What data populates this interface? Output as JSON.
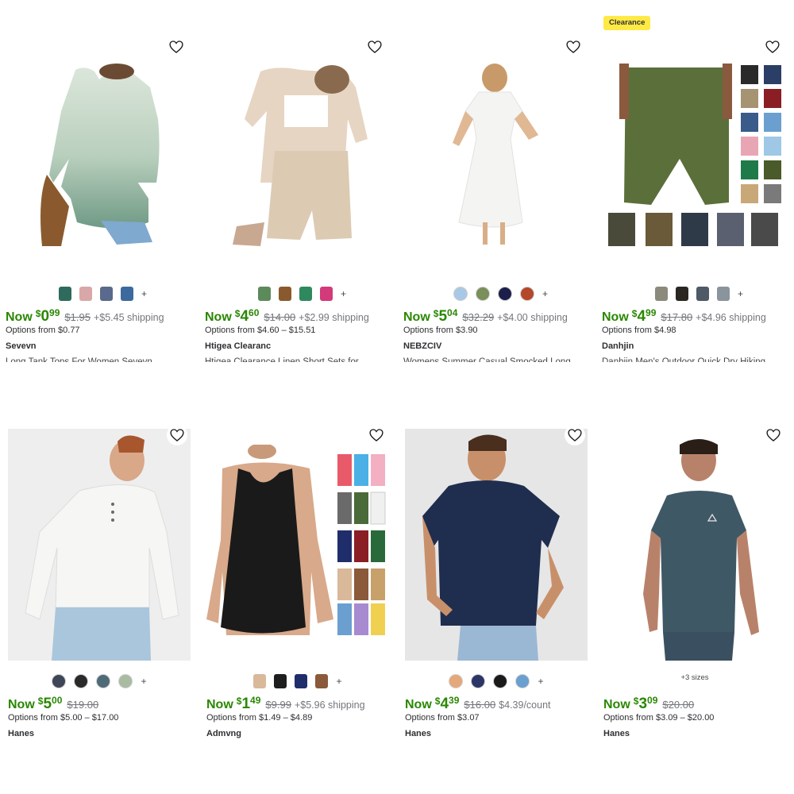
{
  "products": [
    {
      "badge": "",
      "swatch_more": "+",
      "price_prefix": "Now",
      "price_whole": "0",
      "price_cents": "99",
      "was": "$1.95",
      "extra": "+$5.45 shipping",
      "options": "Options from $0.77",
      "brand": "Sevevn",
      "title": "Long Tank Tops For Women Sevevn",
      "swatch_colors": [
        "#2f6b5c",
        "#d9a7a7",
        "#5a6a8c",
        "#3c6a9e"
      ]
    },
    {
      "badge": "",
      "swatch_more": "+",
      "price_prefix": "Now",
      "price_whole": "4",
      "price_cents": "60",
      "was": "$14.00",
      "extra": "+$2.99 shipping",
      "options": "Options from $4.60 – $15.51",
      "brand": "Htigea Clearanc",
      "title": "Htigea Clearance Linen Short Sets for",
      "swatch_colors": [
        "#5d8a5a",
        "#8a5a2e",
        "#2e8a5e",
        "#d23a7a"
      ]
    },
    {
      "badge": "",
      "swatch_more": "+",
      "price_prefix": "Now",
      "price_whole": "5",
      "price_cents": "04",
      "was": "$32.29",
      "extra": "+$4.00 shipping",
      "options": "Options from $3.90",
      "brand": "NEBZCIV",
      "title": "Womens Summer Casual Smocked Long",
      "swatch_colors": [
        "#a9c8e6",
        "#7a8f5a",
        "#1c1f4a",
        "#b5472a"
      ]
    },
    {
      "badge": "Clearance",
      "swatch_more": "+",
      "price_prefix": "Now",
      "price_whole": "4",
      "price_cents": "99",
      "was": "$17.80",
      "extra": "+$4.96 shipping",
      "options": "Options from $4.98",
      "brand": "Danhjin",
      "title": "Danhjin Men's Outdoor Quick Dry Hiking",
      "swatch_colors": [
        "#8c8a7a",
        "#2a2622",
        "#4e5a66",
        "#8a949c"
      ]
    },
    {
      "badge": "",
      "swatch_more": "+",
      "price_prefix": "Now",
      "price_whole": "5",
      "price_cents": "00",
      "was": "$19.00",
      "extra": "",
      "options": "Options from $5.00 – $17.00",
      "brand": "Hanes",
      "title": "",
      "swatch_colors": [
        "#3e4658",
        "#2a2a2a",
        "#4f6b78",
        "#a9bba1"
      ]
    },
    {
      "badge": "",
      "swatch_more": "+",
      "price_prefix": "Now",
      "price_whole": "1",
      "price_cents": "49",
      "was": "$9.99",
      "extra": "+$5.96 shipping",
      "options": "Options from $1.49 – $4.89",
      "brand": "Admvng",
      "title": "",
      "swatch_colors": [
        "#d9b99a",
        "#1e1e1e",
        "#1f2d6a",
        "#8a5a3a"
      ]
    },
    {
      "badge": "",
      "swatch_more": "+",
      "price_prefix": "Now",
      "price_whole": "4",
      "price_cents": "39",
      "was": "$16.00",
      "extra": "$4.39/count",
      "options": "Options from $3.07",
      "brand": "Hanes",
      "title": "",
      "swatch_colors": [
        "#e5a87a",
        "#2b3566",
        "#1a1a1a",
        "#6a9fd0"
      ]
    },
    {
      "badge": "",
      "swatch_more": "",
      "sizes": "+3 sizes",
      "price_prefix": "Now",
      "price_whole": "3",
      "price_cents": "09",
      "was": "$20.00",
      "extra": "",
      "options": "Options from $3.09 – $20.00",
      "brand": "Hanes",
      "title": "",
      "swatch_colors": []
    }
  ]
}
